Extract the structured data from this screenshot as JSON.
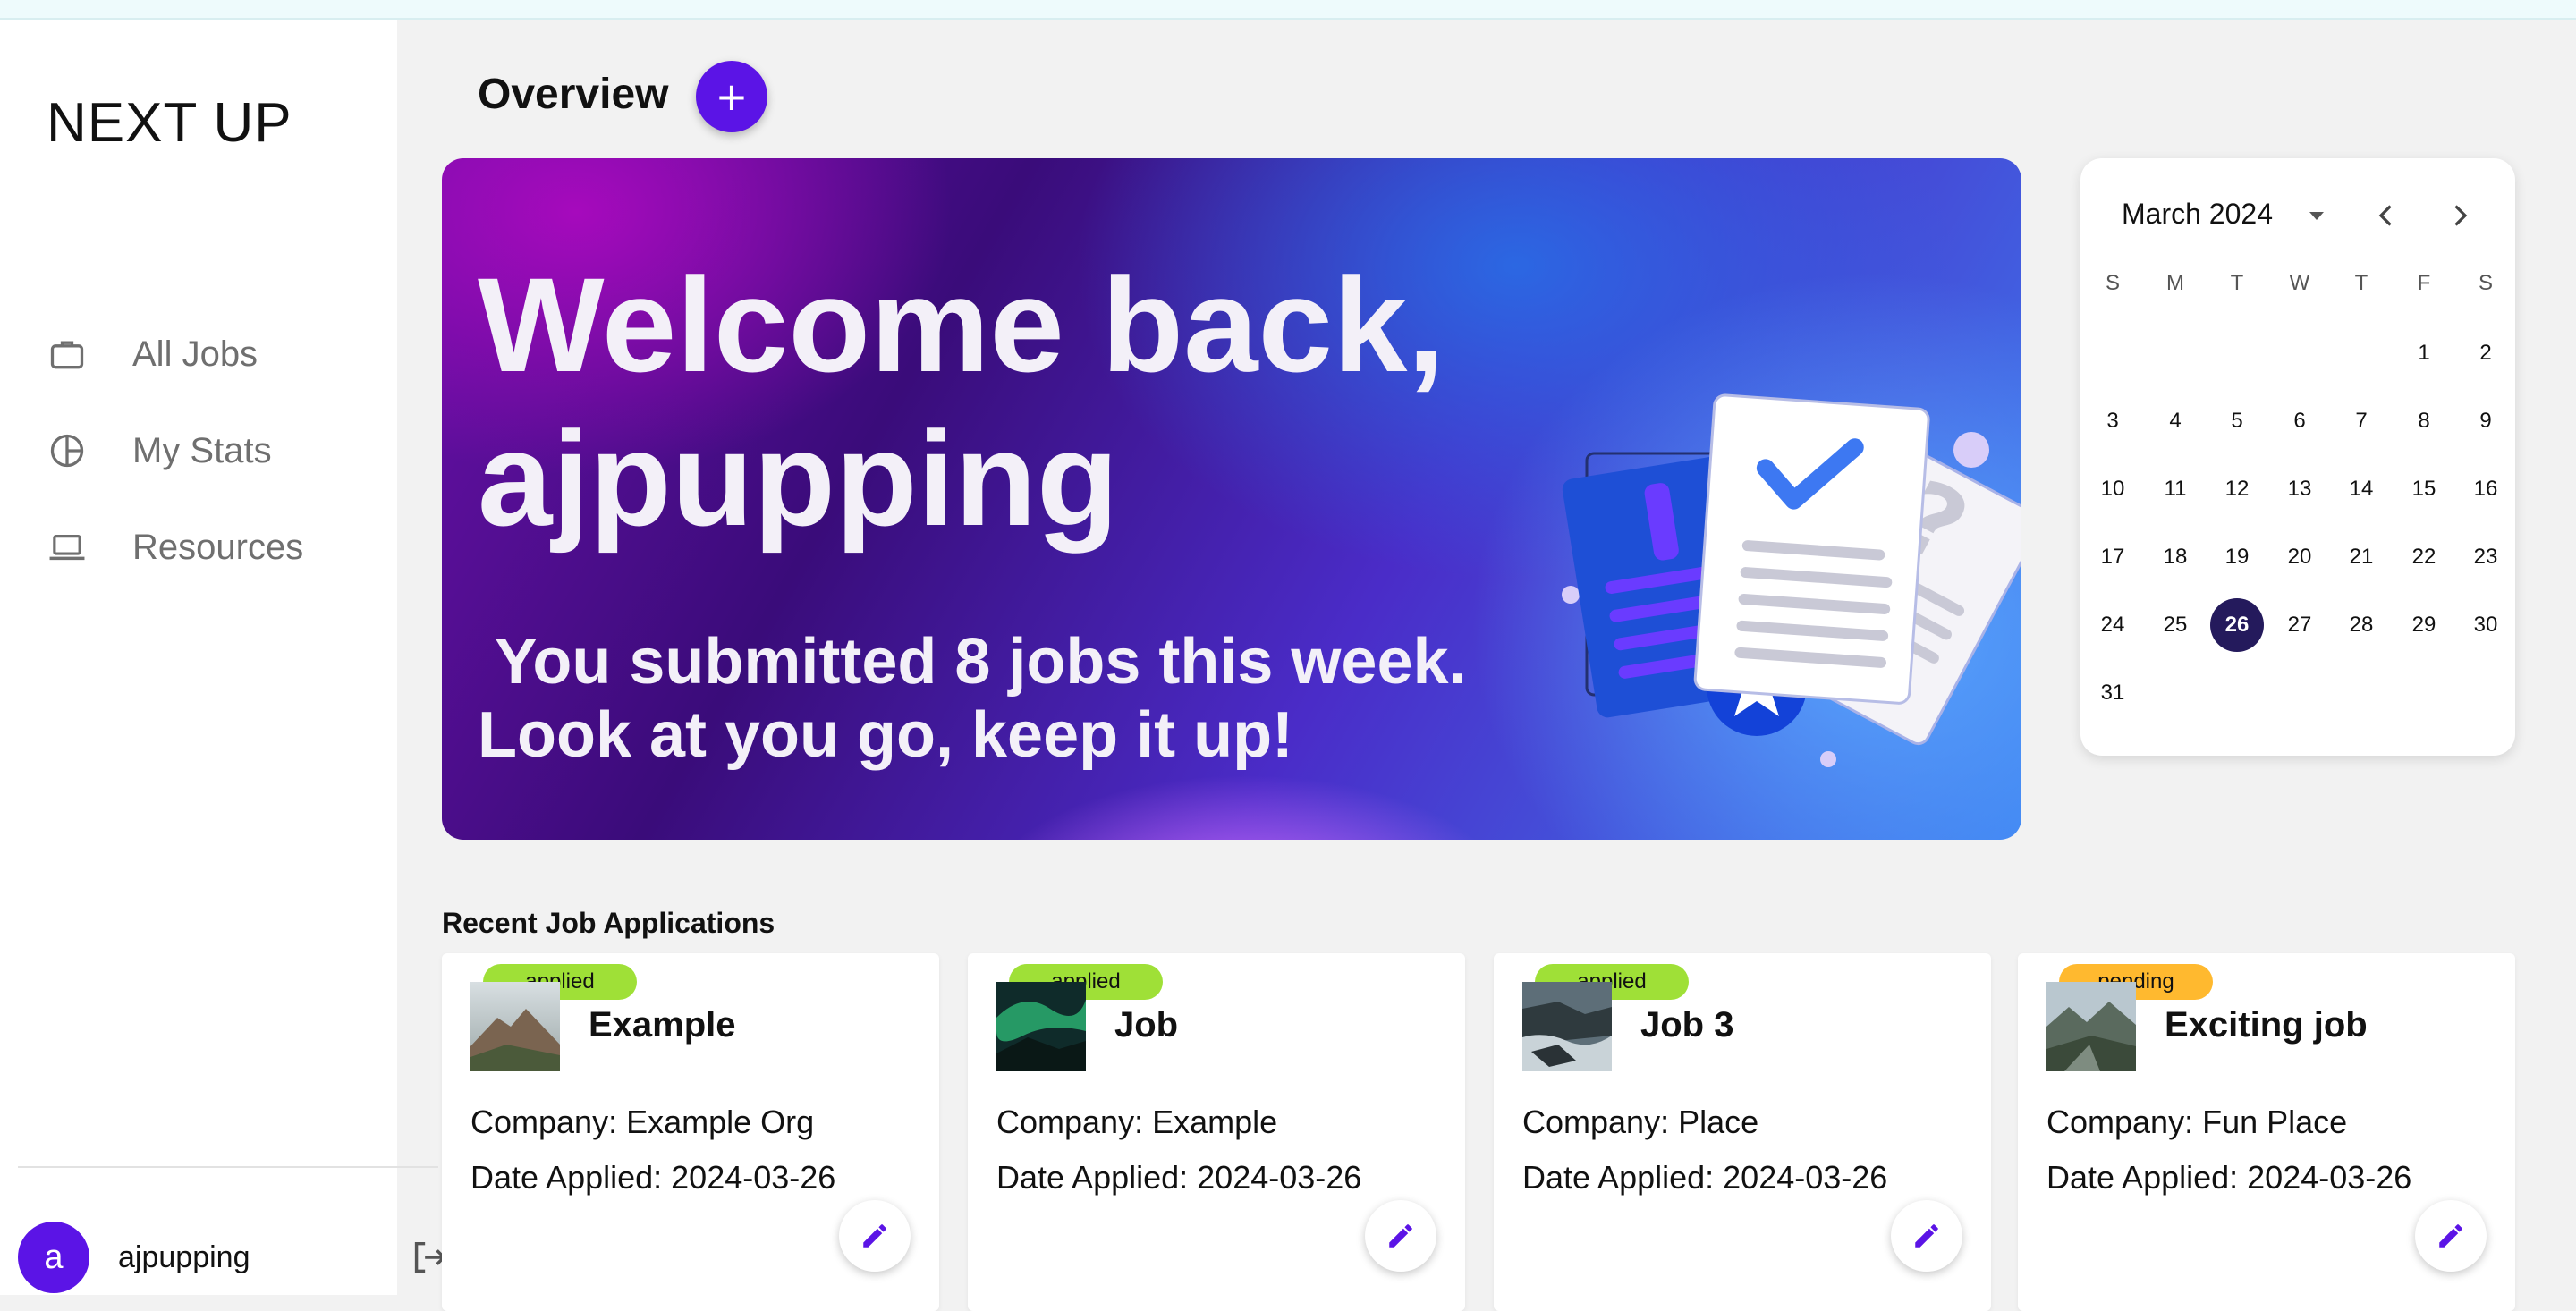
{
  "app": {
    "brand": "NEXT UP"
  },
  "sidebar": {
    "items": [
      {
        "label": "All Jobs",
        "icon": "briefcase-icon"
      },
      {
        "label": "My Stats",
        "icon": "pie-chart-icon"
      },
      {
        "label": "Resources",
        "icon": "laptop-icon"
      }
    ],
    "user": {
      "initial": "a",
      "username": "ajpupping"
    },
    "logout_icon": "logout-icon"
  },
  "header": {
    "title": "Overview",
    "add_label": "+"
  },
  "hero": {
    "greeting_line1": "Welcome back,",
    "greeting_line2": "ajpupping",
    "message_line1": " You submitted 8 jobs this week.",
    "message_line2": "Look at you go, keep it up!"
  },
  "calendar": {
    "month_label": "March 2024",
    "weekdays": [
      "S",
      "M",
      "T",
      "W",
      "T",
      "F",
      "S"
    ],
    "first_weekday_index": 5,
    "days_in_month": 31,
    "selected_day": 26,
    "selected_color": "#241a5c"
  },
  "recent": {
    "title": "Recent Job Applications",
    "company_prefix": "Company: ",
    "date_prefix": "Date Applied: ",
    "cards": [
      {
        "status": "applied",
        "title": "Example",
        "company": "Example Org",
        "date_applied": "2024-03-26",
        "thumb": "mountain"
      },
      {
        "status": "applied",
        "title": "Job",
        "company": "Example",
        "date_applied": "2024-03-26",
        "thumb": "aurora"
      },
      {
        "status": "applied",
        "title": "Job 3",
        "company": "Place",
        "date_applied": "2024-03-26",
        "thumb": "coast"
      },
      {
        "status": "pending",
        "title": "Exciting job",
        "company": "Fun Place",
        "date_applied": "2024-03-26",
        "thumb": "valley"
      }
    ]
  },
  "colors": {
    "accent": "#5b14e6",
    "applied": "#9fe037",
    "pending": "#ffb92f"
  }
}
